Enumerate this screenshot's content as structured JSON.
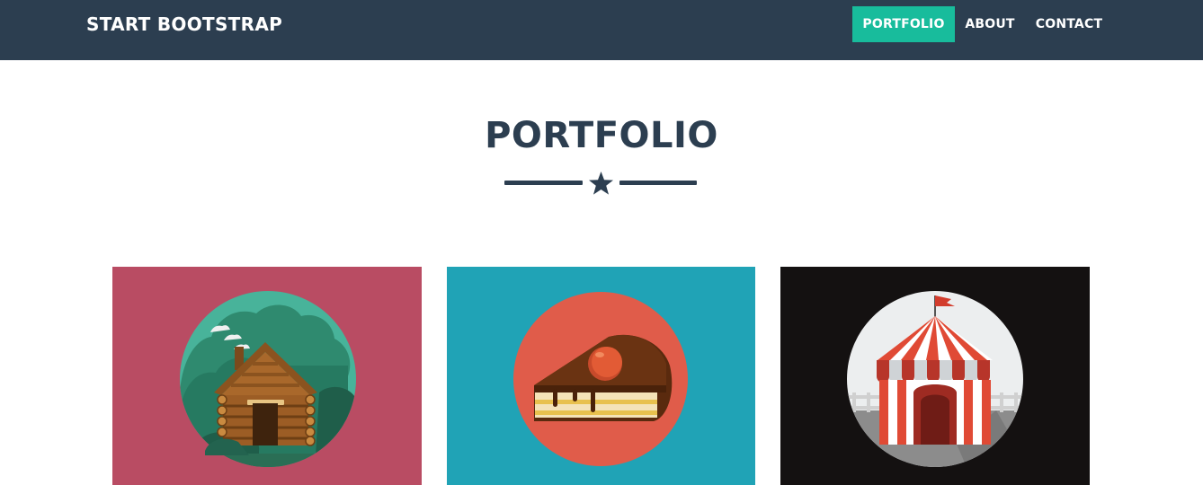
{
  "navbar": {
    "brand": "START BOOTSTRAP",
    "items": [
      {
        "label": "PORTFOLIO",
        "active": true
      },
      {
        "label": "ABOUT",
        "active": false
      },
      {
        "label": "CONTACT",
        "active": false
      }
    ]
  },
  "portfolio": {
    "title": "PORTFOLIO",
    "divider_icon": "star-icon",
    "items": [
      {
        "icon": "cabin-icon",
        "background": "#b94c63"
      },
      {
        "icon": "cake-icon",
        "background": "#20a3b6"
      },
      {
        "icon": "circus-tent-icon",
        "background": "#141111"
      }
    ]
  },
  "colors": {
    "navbar_bg": "#2c3e50",
    "accent": "#18bc9c",
    "text_dark": "#2c3e50"
  }
}
